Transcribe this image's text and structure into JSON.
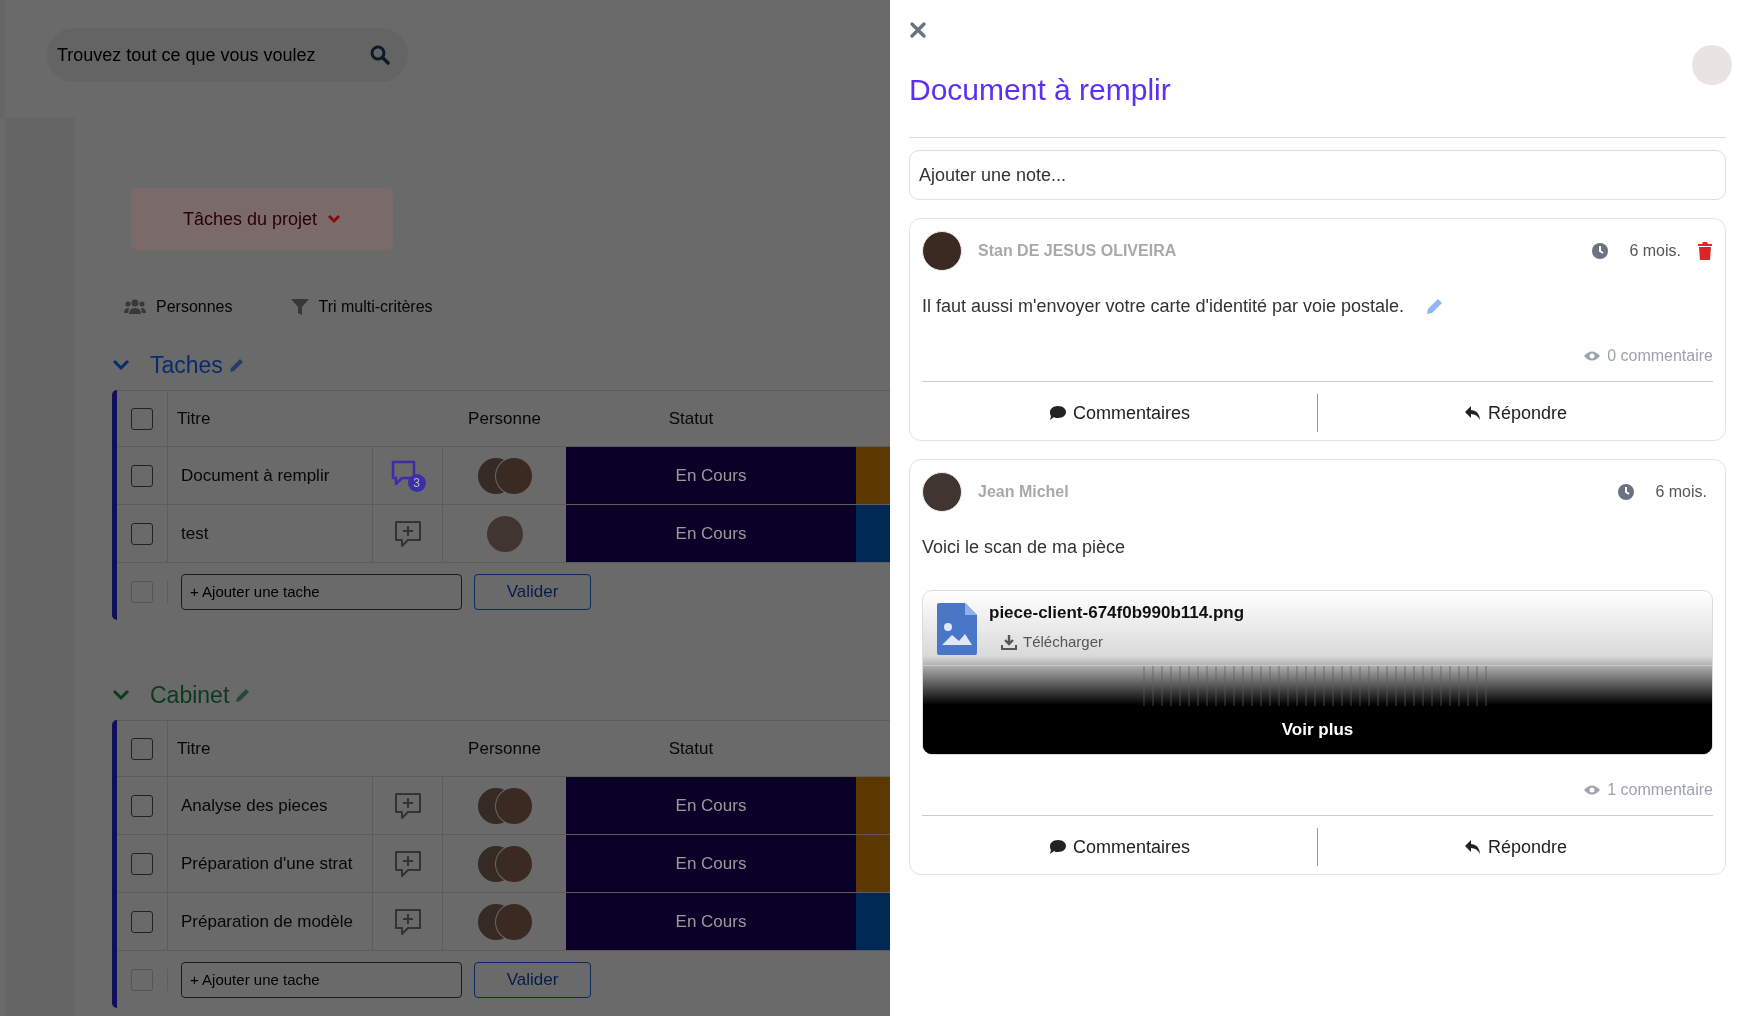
{
  "search": {
    "placeholder": "Trouvez tout ce que vous voulez"
  },
  "project_menu": {
    "label": "Tâches du projet"
  },
  "toolbar": [
    {
      "kind": "people",
      "label": "Personnes"
    },
    {
      "kind": "filter",
      "label": "Tri multi-critères"
    }
  ],
  "groups": [
    {
      "title": "Taches",
      "color": "#0a2a6a",
      "expanded": true,
      "select_all": false,
      "add_disabled": true,
      "columns": [
        "Titre",
        "Personne",
        "Statut"
      ],
      "rows": [
        {
          "title": "Document à remplir",
          "checked": false,
          "comments": "3",
          "multiple": true,
          "status": "En Cours",
          "color": "#5a3800"
        },
        {
          "title": "test",
          "checked": false,
          "multiple": false,
          "status": "En Cours",
          "color": "#002a55"
        }
      ],
      "add_placeholder": "+ Ajouter une tache",
      "add_button": "Valider"
    },
    {
      "title": "Cabinet",
      "color": "#0c3a1c",
      "expanded": true,
      "select_all": false,
      "add_disabled": true,
      "columns": [
        "Titre",
        "Personne",
        "Statut"
      ],
      "rows": [
        {
          "title": "Analyse des pieces",
          "checked": false,
          "multiple": true,
          "status": "En Cours",
          "color": "#5a3800"
        },
        {
          "title": "Préparation d'une strat",
          "checked": false,
          "multiple": true,
          "status": "En Cours",
          "color": "#5a3800"
        },
        {
          "title": "Préparation de modèle",
          "checked": false,
          "multiple": true,
          "status": "En Cours",
          "color": "#002a55"
        }
      ],
      "add_placeholder": "+ Ajouter une tache",
      "add_button": "Valider"
    }
  ],
  "panel": {
    "title": "Document à remplir",
    "note_placeholder": "Ajouter une note...",
    "notes": [
      {
        "author": "Stan DE JESUS OLIVEIRA",
        "time": "6 mois.",
        "own": true,
        "text": "Il faut aussi m'envoyer votre carte d'identité par voie postale.",
        "views": "0 commentaire",
        "actions": [
          "Commentaires",
          "Répondre"
        ]
      },
      {
        "author": "Jean Michel",
        "time": "6 mois.",
        "own": false,
        "text": "Voici le scan de ma pièce",
        "attachment": {
          "name": "piece-client-674f0b990b114.png",
          "download": "Télécharger",
          "more": "Voir plus"
        },
        "views": "1 commentaire",
        "actions": [
          "Commentaires",
          "Répondre"
        ]
      }
    ]
  }
}
